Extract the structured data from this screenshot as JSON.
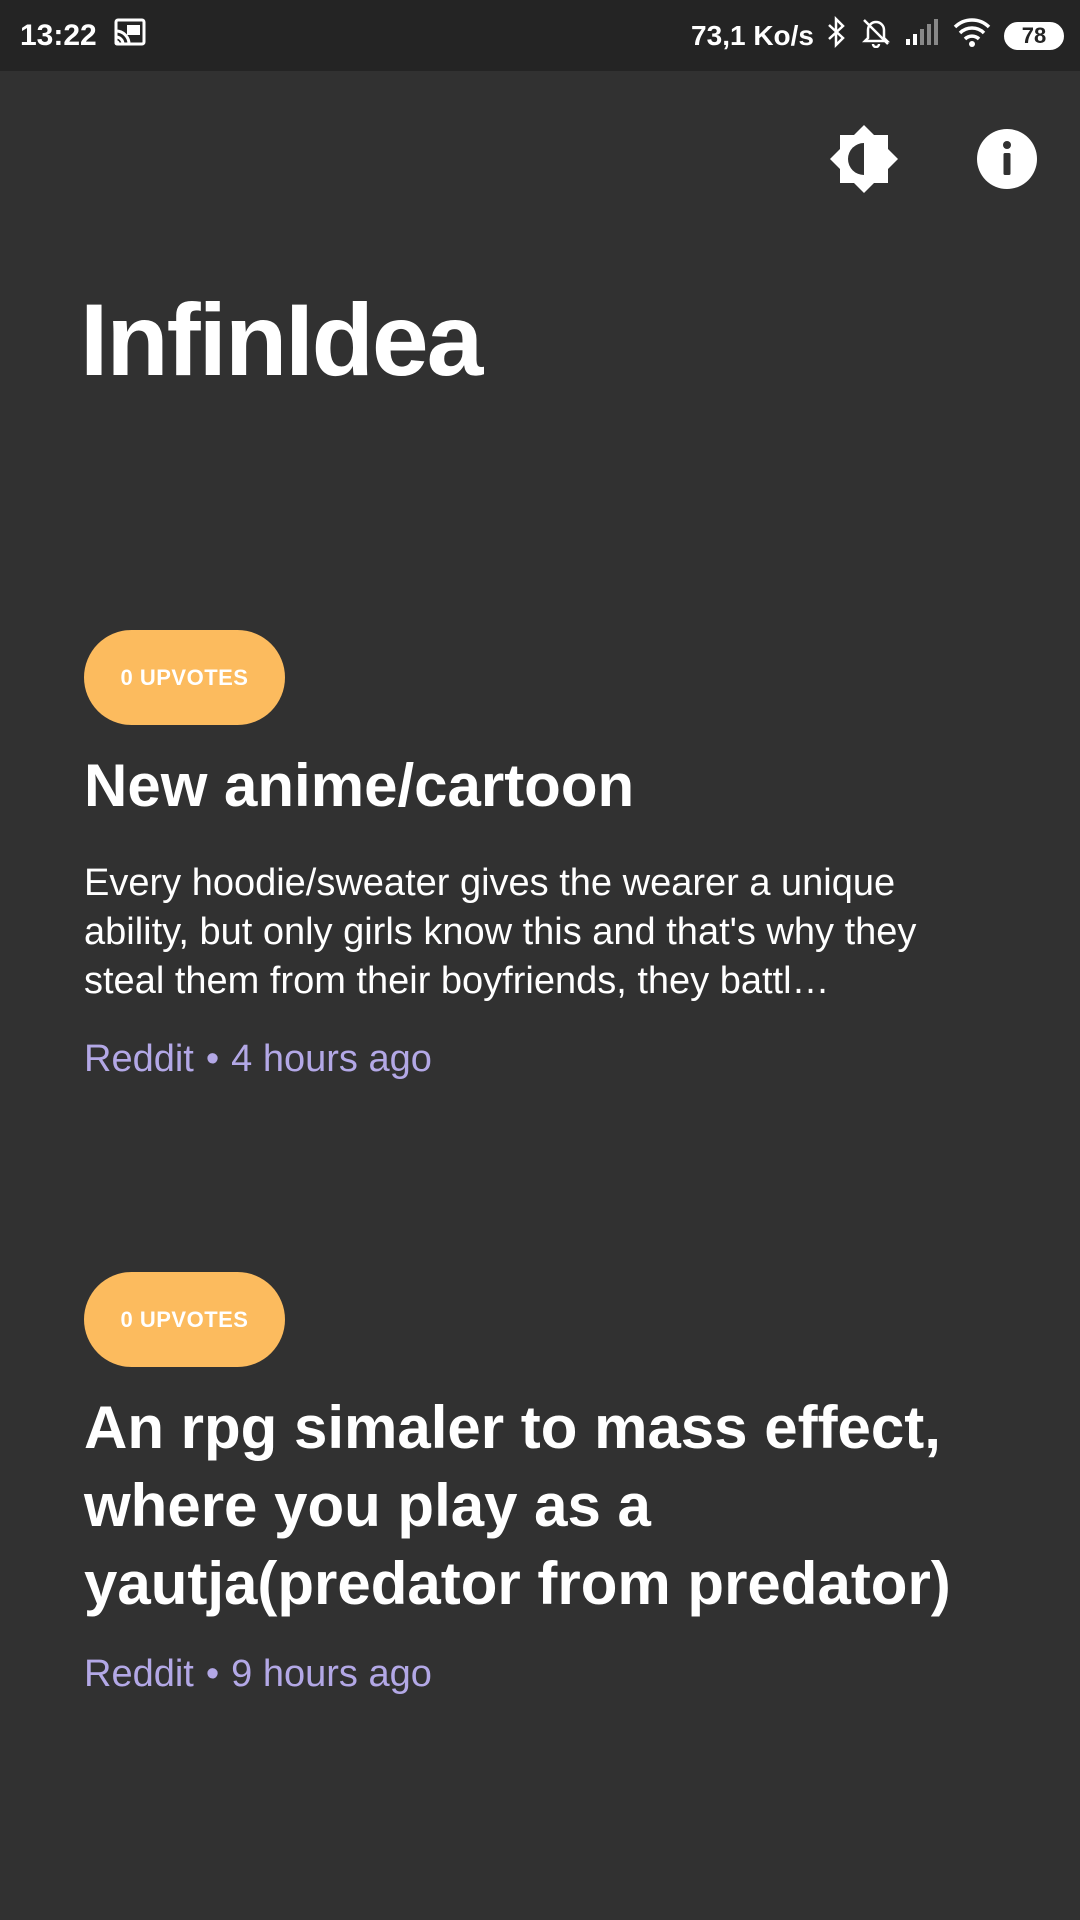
{
  "status_bar": {
    "time": "13:22",
    "network_speed": "73,1 Ko/s",
    "battery": "78",
    "icons": [
      "cast-icon",
      "bluetooth-icon",
      "bell-off-icon",
      "signal-icon",
      "wifi-icon",
      "battery-icon"
    ]
  },
  "header": {
    "app_title": "InfinIdea",
    "theme_icon": "brightness-contrast-icon",
    "info_icon": "info-icon"
  },
  "ideas": [
    {
      "upvotes": "0 UPVOTES",
      "title": "New anime/cartoon",
      "description": "Every hoodie/sweater gives the wearer a unique ability, but only girls know this and that's why they steal them from their boyfriends, they battl…",
      "source": "Reddit",
      "separator": "•",
      "time_ago": "4 hours ago"
    },
    {
      "upvotes": "0 UPVOTES",
      "title": "An rpg simaler to mass effect, where you play as a yautja(predator from predator)",
      "source": "Reddit",
      "separator": "•",
      "time_ago": "9 hours ago"
    }
  ],
  "colors": {
    "background": "#313131",
    "status_bar": "#242424",
    "badge": "#fcbb5e",
    "meta_text": "#b3a8e6"
  }
}
